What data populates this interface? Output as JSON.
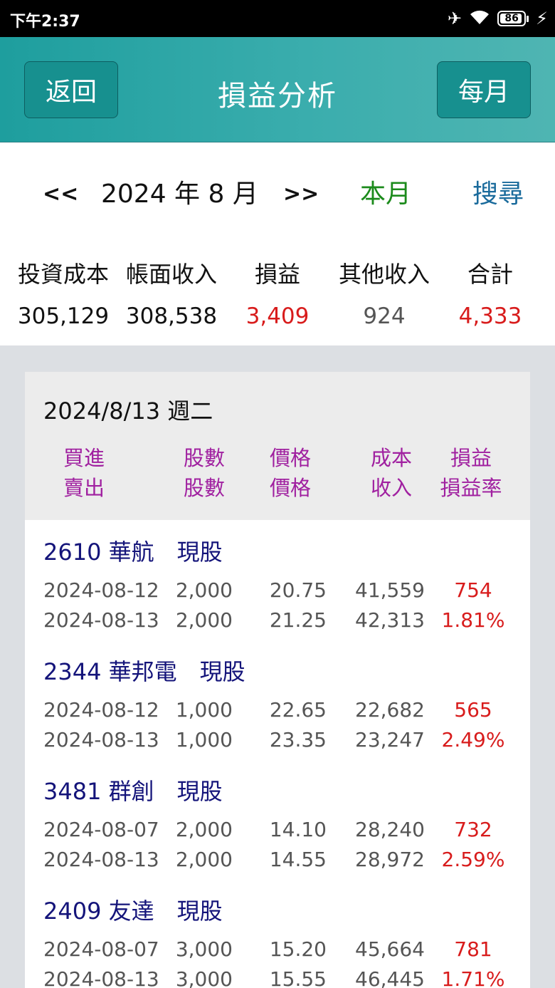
{
  "status_bar": {
    "time": "下午2:37",
    "battery_level": "86"
  },
  "header": {
    "back_label": "返回",
    "title": "損益分析",
    "monthly_label": "每月"
  },
  "nav": {
    "prev_label": "<<",
    "year_month": "2024 年 8 月",
    "next_label": ">>",
    "this_month_label": "本月",
    "search_label": "搜尋"
  },
  "summary": {
    "labels": [
      "投資成本",
      "帳面收入",
      "損益",
      "其他收入",
      "合計"
    ],
    "values": [
      "305,129",
      "308,538",
      "3,409",
      "924",
      "4,333"
    ]
  },
  "card": {
    "date": "2024/8/13 週二",
    "header_line1": [
      "買進",
      "股數",
      "價格",
      "成本",
      "損益"
    ],
    "header_line2": [
      "賣出",
      "股數",
      "價格",
      "收入",
      "損益率"
    ],
    "stocks": [
      {
        "name": "2610 華航　現股",
        "buy": {
          "date": "2024-08-12",
          "shares": "2,000",
          "price": "20.75",
          "amount": "41,559",
          "pl": "754"
        },
        "sell": {
          "date": "2024-08-13",
          "shares": "2,000",
          "price": "21.25",
          "amount": "42,313",
          "pl": "1.81%"
        }
      },
      {
        "name": "2344 華邦電　現股",
        "buy": {
          "date": "2024-08-12",
          "shares": "1,000",
          "price": "22.65",
          "amount": "22,682",
          "pl": "565"
        },
        "sell": {
          "date": "2024-08-13",
          "shares": "1,000",
          "price": "23.35",
          "amount": "23,247",
          "pl": "2.49%"
        }
      },
      {
        "name": "3481 群創　現股",
        "buy": {
          "date": "2024-08-07",
          "shares": "2,000",
          "price": "14.10",
          "amount": "28,240",
          "pl": "732"
        },
        "sell": {
          "date": "2024-08-13",
          "shares": "2,000",
          "price": "14.55",
          "amount": "28,972",
          "pl": "2.59%"
        }
      },
      {
        "name": "2409 友達　現股",
        "buy": {
          "date": "2024-08-07",
          "shares": "3,000",
          "price": "15.20",
          "amount": "45,664",
          "pl": "781"
        },
        "sell": {
          "date": "2024-08-13",
          "shares": "3,000",
          "price": "15.55",
          "amount": "46,445",
          "pl": "1.71%"
        }
      }
    ]
  },
  "colors": {
    "appbar": "#3aadad",
    "positive": "#d81c1c",
    "header_text": "#a020a0",
    "stock_name": "#14147a",
    "this_month": "#1c8b1c",
    "search": "#1a6b9c"
  }
}
